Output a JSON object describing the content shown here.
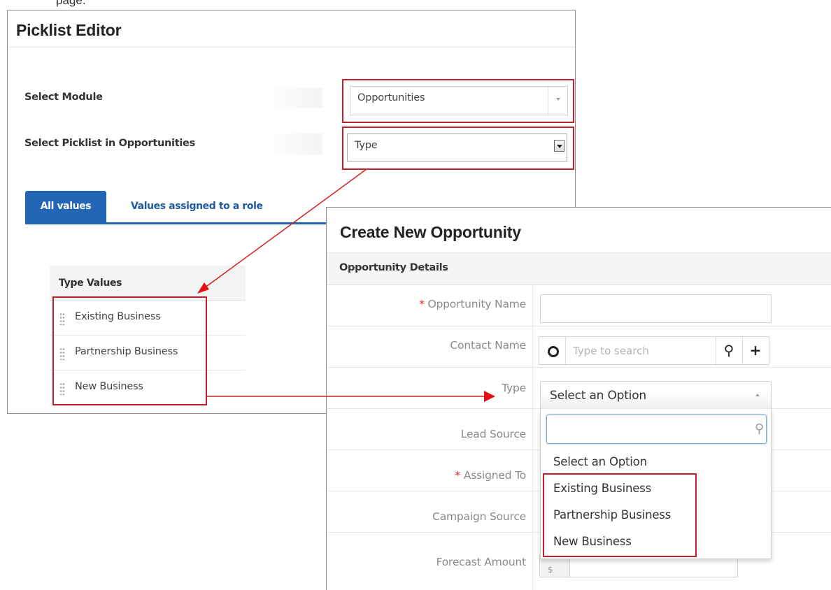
{
  "top_clip": "page.",
  "picklist_editor": {
    "title": "Picklist Editor",
    "select_module_label": "Select Module",
    "select_module_value": "Opportunities",
    "select_picklist_label": "Select Picklist in Opportunities",
    "select_picklist_value": "Type",
    "tabs": [
      {
        "label": "All values",
        "active": true
      },
      {
        "label": "Values assigned to a role",
        "active": false
      }
    ],
    "table_header": "Type Values",
    "values": [
      "Existing Business",
      "Partnership Business",
      "New Business"
    ]
  },
  "create_opportunity": {
    "title": "Create New Opportunity",
    "section": "Opportunity Details",
    "fields": {
      "opportunity_name": {
        "label": "Opportunity Name",
        "required_mark": "*",
        "value": ""
      },
      "contact_name": {
        "label": "Contact Name",
        "placeholder": "Type to search"
      },
      "type": {
        "label": "Type",
        "value": "Select an Option"
      },
      "lead_source": {
        "label": "Lead Source"
      },
      "assigned_to": {
        "label": "Assigned To",
        "required_mark": "*"
      },
      "campaign_source": {
        "label": "Campaign Source"
      },
      "forecast_amount": {
        "label": "Forecast Amount",
        "currency": "$"
      }
    },
    "type_dropdown": {
      "search_value": "",
      "options": [
        "Select an Option",
        "Existing Business",
        "Partnership Business",
        "New Business"
      ]
    }
  },
  "icons": {
    "clear": "circle-icon",
    "search": "search-icon",
    "add": "plus-icon",
    "drag": "drag-handle-icon",
    "dropdown_arrow": "chevron-down-icon"
  },
  "colors": {
    "highlight": "#c4202b",
    "tab_active": "#2466b5",
    "required": "#d42020"
  }
}
